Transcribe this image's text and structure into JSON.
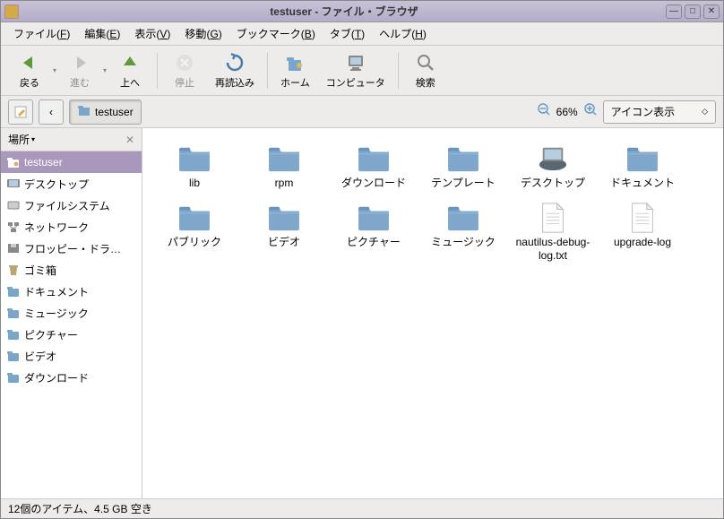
{
  "window": {
    "title": "testuser - ファイル・ブラウザ"
  },
  "menu": {
    "file": "ファイル",
    "file_u": "F",
    "edit": "編集",
    "edit_u": "E",
    "view": "表示",
    "view_u": "V",
    "go": "移動",
    "go_u": "G",
    "bookmarks": "ブックマーク",
    "bookmarks_u": "B",
    "tab": "タブ",
    "tab_u": "T",
    "help": "ヘルプ",
    "help_u": "H"
  },
  "toolbar": {
    "back": "戻る",
    "forward": "進む",
    "up": "上へ",
    "stop": "停止",
    "reload": "再読込み",
    "home": "ホーム",
    "computer": "コンピュータ",
    "search": "検索"
  },
  "location": {
    "path_label": "testuser",
    "zoom_pct": "66%",
    "view_mode": "アイコン表示"
  },
  "sidebar": {
    "header": "場所",
    "items": [
      {
        "label": "testuser",
        "icon": "home",
        "selected": true
      },
      {
        "label": "デスクトップ",
        "icon": "desktop"
      },
      {
        "label": "ファイルシステム",
        "icon": "disk"
      },
      {
        "label": "ネットワーク",
        "icon": "network"
      },
      {
        "label": "フロッピー・ドラ…",
        "icon": "floppy"
      },
      {
        "label": "ゴミ箱",
        "icon": "trash"
      },
      {
        "label": "ドキュメント",
        "icon": "folder"
      },
      {
        "label": "ミュージック",
        "icon": "folder"
      },
      {
        "label": "ピクチャー",
        "icon": "folder"
      },
      {
        "label": "ビデオ",
        "icon": "folder"
      },
      {
        "label": "ダウンロード",
        "icon": "folder"
      }
    ]
  },
  "content": {
    "items": [
      {
        "label": "lib",
        "type": "folder"
      },
      {
        "label": "rpm",
        "type": "folder"
      },
      {
        "label": "ダウンロード",
        "type": "folder"
      },
      {
        "label": "テンプレート",
        "type": "folder"
      },
      {
        "label": "デスクトップ",
        "type": "desktop"
      },
      {
        "label": "ドキュメント",
        "type": "folder"
      },
      {
        "label": "パブリック",
        "type": "folder"
      },
      {
        "label": "ビデオ",
        "type": "folder"
      },
      {
        "label": "ピクチャー",
        "type": "folder"
      },
      {
        "label": "ミュージック",
        "type": "folder"
      },
      {
        "label": "nautilus-debug-log.txt",
        "type": "file"
      },
      {
        "label": "upgrade-log",
        "type": "file"
      }
    ]
  },
  "status": {
    "text": "12個のアイテム、4.5 GB 空き"
  }
}
